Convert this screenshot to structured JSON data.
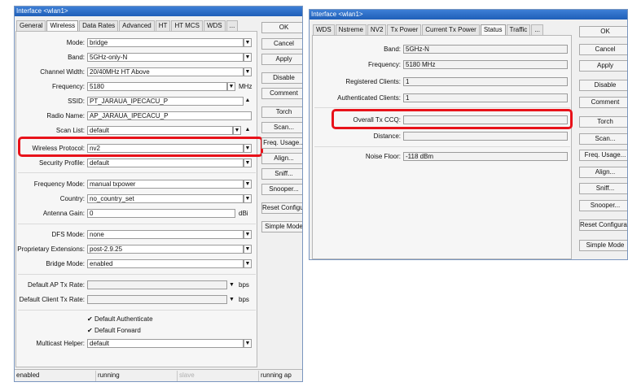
{
  "w1": {
    "title": "Interface <wlan1>",
    "tabs": [
      "General",
      "Wireless",
      "Data Rates",
      "Advanced",
      "HT",
      "HT MCS",
      "WDS",
      "..."
    ],
    "fields": {
      "mode": {
        "label": "Mode:",
        "value": "bridge"
      },
      "band": {
        "label": "Band:",
        "value": "5GHz-only-N"
      },
      "channel_width": {
        "label": "Channel Width:",
        "value": "20/40MHz HT Above"
      },
      "frequency": {
        "label": "Frequency:",
        "value": "5180",
        "unit": "MHz"
      },
      "ssid": {
        "label": "SSID:",
        "value": "PT_JARAUA_IPECACU_P"
      },
      "radio_name": {
        "label": "Radio Name:",
        "value": "AP_JARAUA_IPECACU_P"
      },
      "scan_list": {
        "label": "Scan List:",
        "value": "default"
      },
      "wireless_protocol": {
        "label": "Wireless Protocol:",
        "value": "nv2"
      },
      "security_profile": {
        "label": "Security Profile:",
        "value": "default"
      },
      "frequency_mode": {
        "label": "Frequency Mode:",
        "value": "manual txpower"
      },
      "country": {
        "label": "Country:",
        "value": "no_country_set"
      },
      "antenna_gain": {
        "label": "Antenna Gain:",
        "value": "0",
        "unit": "dBi"
      },
      "dfs_mode": {
        "label": "DFS Mode:",
        "value": "none"
      },
      "proprietary_ext": {
        "label": "Proprietary Extensions:",
        "value": "post-2.9.25"
      },
      "bridge_mode": {
        "label": "Bridge Mode:",
        "value": "enabled"
      },
      "ap_tx_rate": {
        "label": "Default AP Tx Rate:",
        "value": "",
        "unit": "bps"
      },
      "client_tx_rate": {
        "label": "Default Client Tx Rate:",
        "value": "",
        "unit": "bps"
      },
      "default_authenticate": {
        "label": "Default Authenticate"
      },
      "default_forward": {
        "label": "Default Forward"
      },
      "multicast_helper": {
        "label": "Multicast Helper:",
        "value": "default"
      }
    },
    "buttons": [
      "OK",
      "Cancel",
      "Apply",
      "Disable",
      "Comment",
      "Torch",
      "Scan...",
      "Freq. Usage...",
      "Align...",
      "Sniff...",
      "Snooper...",
      "Reset Configuration",
      "Simple Mode"
    ],
    "status": [
      "enabled",
      "running",
      "slave",
      "running ap"
    ]
  },
  "w2": {
    "title": "Interface <wlan1>",
    "tabs": [
      "WDS",
      "Nstreme",
      "NV2",
      "Tx Power",
      "Current Tx Power",
      "Status",
      "Traffic",
      "..."
    ],
    "fields": {
      "band": {
        "label": "Band:",
        "value": "5GHz-N"
      },
      "frequency": {
        "label": "Frequency:",
        "value": "5180 MHz"
      },
      "registered_clients": {
        "label": "Registered Clients:",
        "value": "1"
      },
      "authenticated_clients": {
        "label": "Authenticated Clients:",
        "value": "1"
      },
      "overall_tx_ccq": {
        "label": "Overall Tx CCQ:",
        "value": ""
      },
      "distance": {
        "label": "Distance:",
        "value": ""
      },
      "noise_floor": {
        "label": "Noise Floor:",
        "value": "-118 dBm"
      }
    },
    "buttons": [
      "OK",
      "Cancel",
      "Apply",
      "Disable",
      "Comment",
      "Torch",
      "Scan...",
      "Freq. Usage...",
      "Align...",
      "Sniff...",
      "Snooper...",
      "Reset Configuration",
      "Simple Mode"
    ]
  },
  "colors": {
    "highlight": "#e8121a",
    "titlebar": "#2a6cc8"
  }
}
